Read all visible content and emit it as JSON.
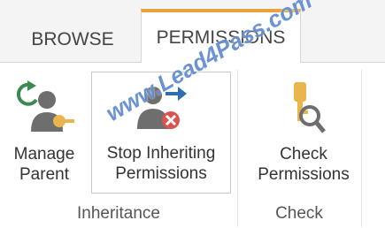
{
  "tabs": [
    {
      "label": "BROWSE"
    },
    {
      "label": "PERMISSIONS"
    }
  ],
  "commands": {
    "manage_parent": {
      "label_line1": "Manage",
      "label_line2": "Parent",
      "icon": "manage-parent-icon"
    },
    "stop_inheriting": {
      "label_line1": "Stop Inheriting",
      "label_line2": "Permissions",
      "icon": "stop-inheriting-icon"
    },
    "check_permissions": {
      "label_line1": "Check",
      "label_line2": "Permissions",
      "icon": "check-permissions-icon"
    }
  },
  "groups": {
    "inheritance": "Inheritance",
    "check": "Check"
  },
  "watermark": "www.Lead4Pass.com",
  "colors": {
    "active_tab_accent": "#e8a33b",
    "person_gray": "#6e6e6e",
    "arrow_green": "#3a8a52",
    "arrow_blue": "#2e6db4",
    "key_gold": "#e8b64c",
    "stop_red": "#d9534f"
  }
}
